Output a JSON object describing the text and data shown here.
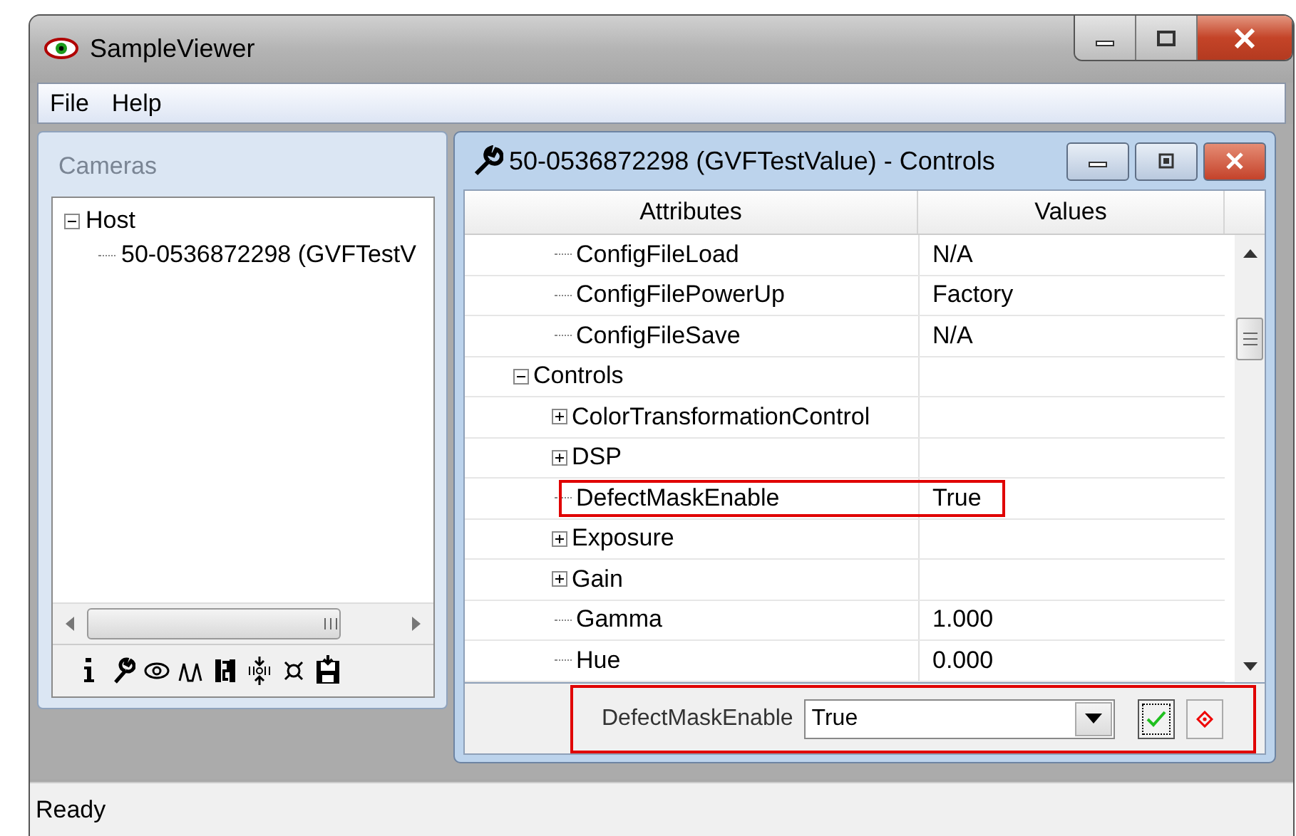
{
  "window": {
    "title": "SampleViewer"
  },
  "menu": [
    "File",
    "Help"
  ],
  "cameras": {
    "title": "Cameras",
    "tree": [
      {
        "label": "Host",
        "expanded": true,
        "children": [
          {
            "label": "50-0536872298 (GVFTestV"
          }
        ]
      }
    ]
  },
  "controls_window": {
    "title": "50-0536872298 (GVFTestValue) - Controls",
    "columns": [
      "Attributes",
      "Values"
    ],
    "tree": [
      {
        "children": [
          {
            "label": "ConfigFileLoad",
            "value": "N/A"
          },
          {
            "label": "ConfigFilePowerUp",
            "value": "Factory"
          },
          {
            "label": "ConfigFileSave",
            "value": "N/A"
          }
        ]
      },
      {
        "label": "Controls",
        "expanded": true,
        "children": [
          {
            "label": "ColorTransformationControl",
            "expanded": false,
            "highlighted": false
          },
          {
            "label": "DSP",
            "expanded": false,
            "highlighted": false
          },
          {
            "label": "DefectMaskEnable",
            "value": "True",
            "highlighted": true
          },
          {
            "label": "Exposure",
            "expanded": false,
            "highlighted": false
          },
          {
            "label": "Gain",
            "expanded": false,
            "highlighted": false
          },
          {
            "label": "Gamma",
            "value": "1.000",
            "highlighted": false
          },
          {
            "label": "Hue",
            "value": "0.000",
            "highlighted": false
          }
        ]
      }
    ],
    "editor": {
      "label": "DefectMaskEnable",
      "value": "True",
      "highlighted": true
    }
  },
  "status_bar": "Ready"
}
